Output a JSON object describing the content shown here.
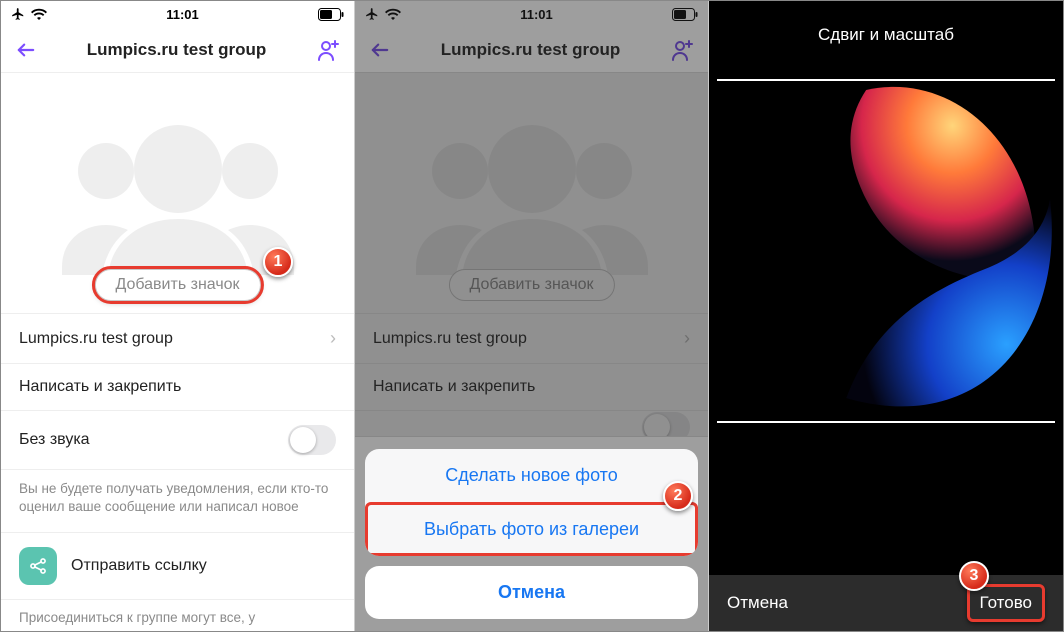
{
  "status": {
    "time": "11:01"
  },
  "screen1": {
    "header_title": "Lumpics.ru test group",
    "add_badge": "Добавить значок",
    "row_groupname": "Lumpics.ru test group",
    "row_pin": "Написать и закрепить",
    "row_mute": "Без звука",
    "note": "Вы не будете получать уведомления, если кто-то оценил ваше сообщение или написал новое",
    "row_share": "Отправить ссылку",
    "cutoff": "Присоединиться к группе могут все, у"
  },
  "screen2": {
    "header_title": "Lumpics.ru test group",
    "add_badge": "Добавить значок",
    "row_groupname": "Lumpics.ru test group",
    "row_pin": "Написать и закрепить",
    "sheet": {
      "take_photo": "Сделать новое фото",
      "choose_photo": "Выбрать фото из галереи",
      "cancel": "Отмена"
    }
  },
  "screen3": {
    "title": "Сдвиг и масштаб",
    "cancel": "Отмена",
    "done": "Готово"
  },
  "callouts": {
    "one": "1",
    "two": "2",
    "three": "3"
  }
}
